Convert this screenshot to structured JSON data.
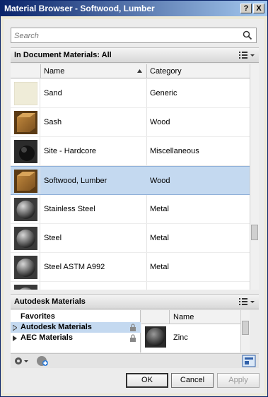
{
  "window": {
    "title": "Material Browser - Softwood, Lumber",
    "help_label": "?",
    "close_label": "X"
  },
  "search": {
    "placeholder": "Search"
  },
  "document_section": {
    "title": "In Document Materials: All"
  },
  "grid": {
    "headers": {
      "name": "Name",
      "category": "Category"
    },
    "rows": [
      {
        "name": "Sand",
        "category": "Generic",
        "swatch": "sand"
      },
      {
        "name": "Sash",
        "category": "Wood",
        "swatch": "wood"
      },
      {
        "name": "Site - Hardcore",
        "category": "Miscellaneous",
        "swatch": "dark"
      },
      {
        "name": "Softwood, Lumber",
        "category": "Wood",
        "swatch": "wood",
        "selected": true
      },
      {
        "name": "Stainless Steel",
        "category": "Metal",
        "swatch": "steel"
      },
      {
        "name": "Steel",
        "category": "Metal",
        "swatch": "steel"
      },
      {
        "name": "Steel ASTM A992",
        "category": "Metal",
        "swatch": "steel"
      }
    ]
  },
  "library_section": {
    "title": "Autodesk Materials"
  },
  "tree": {
    "items": [
      {
        "label": "Favorites"
      },
      {
        "label": "Autodesk Materials"
      },
      {
        "label": "AEC Materials"
      }
    ]
  },
  "library_list": {
    "header": "Name",
    "rows": [
      {
        "name": "Zinc"
      }
    ]
  },
  "buttons": {
    "ok": "OK",
    "cancel": "Cancel",
    "apply": "Apply"
  },
  "colors": {
    "title_start": "#0a246a",
    "title_end": "#a6caf0",
    "selection": "#c4d9f0"
  }
}
